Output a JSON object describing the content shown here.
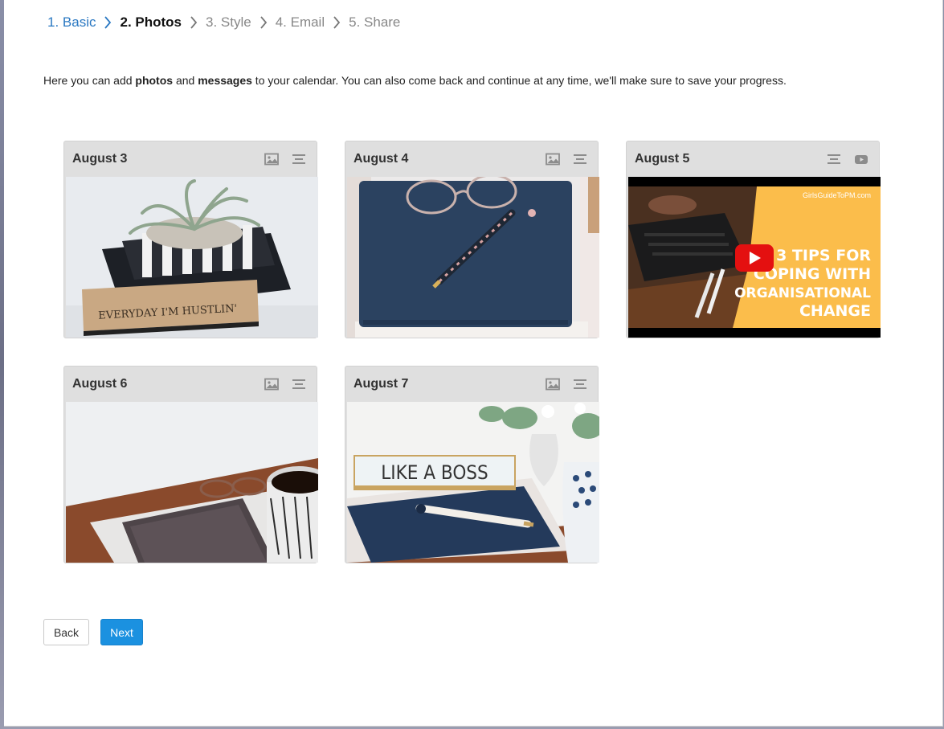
{
  "steps": [
    {
      "label": "1. Basic",
      "state": "done"
    },
    {
      "label": "2. Photos",
      "state": "active"
    },
    {
      "label": "3. Style",
      "state": "todo"
    },
    {
      "label": "4. Email",
      "state": "todo"
    },
    {
      "label": "5. Share",
      "state": "todo"
    }
  ],
  "intro": {
    "part1": "Here you can add ",
    "photos": "photos",
    "part2": " and ",
    "messages": "messages",
    "part3": " to your calendar. You can also come back and continue at any time, we'll make sure to save your progress."
  },
  "cards": [
    {
      "title": "August 3",
      "tools": [
        "image-icon",
        "align-center-icon"
      ],
      "media": "photo"
    },
    {
      "title": "August 4",
      "tools": [
        "image-icon",
        "align-center-icon"
      ],
      "media": "photo"
    },
    {
      "title": "August 5",
      "tools": [
        "align-center-icon",
        "youtube-icon"
      ],
      "media": "video",
      "video_text": {
        "brand": "GirlsGuideToPM.com",
        "line1": "3 TIPS FOR",
        "line2": "COPING WITH",
        "line3": "ORGANISATIONAL",
        "line4": "CHANGE"
      }
    },
    {
      "title": "August 6",
      "tools": [
        "image-icon",
        "align-center-icon"
      ],
      "media": "photo"
    },
    {
      "title": "August 7",
      "tools": [
        "image-icon",
        "align-center-icon"
      ],
      "media": "photo"
    }
  ],
  "photo_text": {
    "card1": "EVERYDAY I'M HUSTLIN'",
    "card5": "LIKE A BOSS"
  },
  "buttons": {
    "back": "Back",
    "next": "Next"
  },
  "colors": {
    "link": "#2a78c2",
    "primary": "#1b91e0",
    "card_header": "#dfdfdf"
  }
}
